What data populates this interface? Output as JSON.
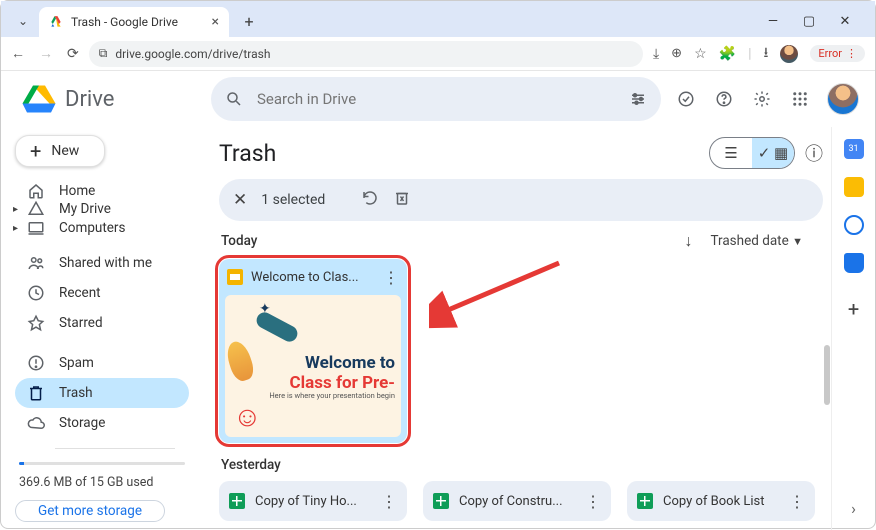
{
  "browser": {
    "tab_title": "Trash - Google Drive",
    "url": "drive.google.com/drive/trash",
    "error_label": "Error"
  },
  "header": {
    "product": "Drive",
    "search_placeholder": "Search in Drive"
  },
  "sidebar": {
    "new_label": "New",
    "items": {
      "home": "Home",
      "mydrive": "My Drive",
      "computers": "Computers",
      "shared": "Shared with me",
      "recent": "Recent",
      "starred": "Starred",
      "spam": "Spam",
      "trash": "Trash",
      "storage": "Storage"
    },
    "storage_used": "369.6 MB of 15 GB used",
    "get_more": "Get more storage"
  },
  "page": {
    "title": "Trash",
    "selection": "1 selected",
    "sections": {
      "today": "Today",
      "yesterday": "Yesterday"
    },
    "sort_label": "Trashed date"
  },
  "files": {
    "today_card": {
      "name": "Welcome to Clas...",
      "thumb_line1": "Welcome to",
      "thumb_line2": "Class for Pre-",
      "thumb_sub": "Here is where your presentation begin"
    },
    "yesterday": [
      {
        "name": "Copy of Tiny Ho..."
      },
      {
        "name": "Copy of Constru..."
      },
      {
        "name": "Copy of Book List"
      }
    ]
  }
}
